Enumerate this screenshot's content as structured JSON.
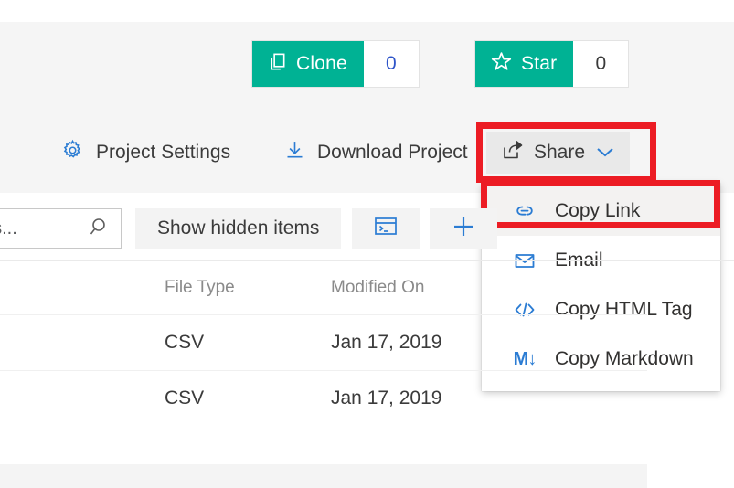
{
  "theme": {
    "accent_green": "#00b294",
    "accent_blue": "#2b7cd3",
    "highlight_red": "#ec1c24",
    "text_dark": "#3b3b3b",
    "page_bg": "#f5f5f5"
  },
  "stats": {
    "clone": {
      "label": "Clone",
      "count": "0",
      "icon": "clone-icon"
    },
    "star": {
      "label": "Star",
      "count": "0",
      "icon": "star-icon"
    }
  },
  "toolbar": {
    "project_settings": {
      "label": "Project Settings",
      "icon": "gear-icon"
    },
    "download_project": {
      "label": "Download Project",
      "icon": "download-icon"
    },
    "share": {
      "label": "Share",
      "icon": "share-icon",
      "chevron": "chevron-down-icon"
    }
  },
  "share_menu": {
    "items": [
      {
        "label": "Copy Link",
        "icon": "link-icon",
        "hovered": true
      },
      {
        "label": "Email",
        "icon": "envelope-icon",
        "hovered": false
      },
      {
        "label": "Copy HTML Tag",
        "icon": "code-icon",
        "hovered": false
      },
      {
        "label": "Copy Markdown",
        "icon": "markdown-icon",
        "glyph": "M↓",
        "hovered": false
      }
    ]
  },
  "filter_bar": {
    "search": {
      "value": "oks...",
      "placeholder": "Search files and notebooks...",
      "icon": "search-icon"
    },
    "show_hidden_items": "Show hidden items",
    "terminal_button": {
      "icon": "terminal-icon"
    },
    "new_button": {
      "icon": "plus-icon"
    }
  },
  "file_table": {
    "columns": [
      "",
      "File Type",
      "Modified On"
    ],
    "rows": [
      {
        "name": "",
        "file_type": "CSV",
        "modified_on": "Jan 17, 2019"
      },
      {
        "name": "",
        "file_type": "CSV",
        "modified_on": "Jan 17, 2019"
      }
    ],
    "clipped_row": {
      "text": ""
    }
  }
}
